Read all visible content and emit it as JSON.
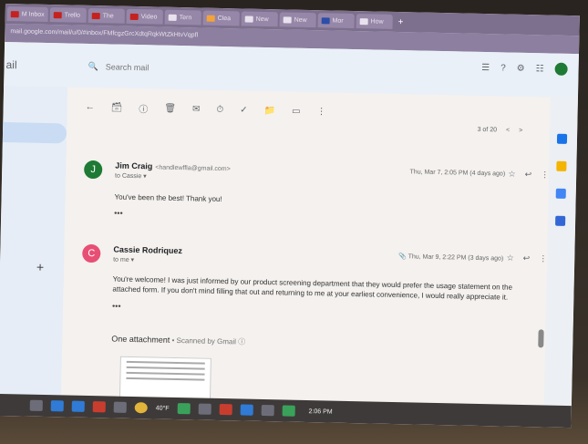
{
  "browser": {
    "tabs": [
      {
        "label": "M Inbox",
        "icon": "gmail"
      },
      {
        "label": "Trello",
        "icon": "youtube"
      },
      {
        "label": "The",
        "icon": "youtube"
      },
      {
        "label": "Video",
        "icon": "youtube"
      },
      {
        "label": "Tern",
        "icon": "google"
      },
      {
        "label": "Clea",
        "icon": "office"
      },
      {
        "label": "New",
        "icon": "google"
      },
      {
        "label": "New",
        "icon": "google"
      },
      {
        "label": "Mor",
        "icon": "outlook"
      },
      {
        "label": "How",
        "icon": "google"
      }
    ],
    "new_tab": "+",
    "url": "mail.google.com/mail/u/0/#inbox/FMfcgzGrcXdtqRqkWtZkHtvVqpfl"
  },
  "gmail": {
    "brand": "ail",
    "search_placeholder": "Search mail",
    "pager": {
      "range": "3 of 20",
      "prev": "<",
      "next": ">"
    },
    "thread": [
      {
        "initial": "J",
        "avatar_color": "#1e7a34",
        "sender": "Jim Craig",
        "email": "<handlewffla@gmail.com>",
        "recipient": "to Cassie ▾",
        "timestamp": "Thu, Mar 7, 2:05 PM (4 days ago)",
        "body": "You've been the best! Thank you!",
        "more": "•••"
      },
      {
        "initial": "C",
        "avatar_color": "#e84f74",
        "sender": "Cassie Rodriquez",
        "recipient": "to me ▾",
        "timestamp": "Thu, Mar 9, 2:22 PM (3 days ago)",
        "body": "You're welcome! I was just informed by our product screening department that they would prefer the usage statement on the attached form. If you don't mind filling that out and returning to me at your earliest convenience, I would really appreciate it.",
        "more": "•••"
      }
    ],
    "attachment": {
      "title": "One attachment",
      "scanned": " • Scanned by Gmail ⓘ"
    }
  },
  "taskbar": {
    "temperature": "40°F",
    "time": "2:06 PM"
  }
}
